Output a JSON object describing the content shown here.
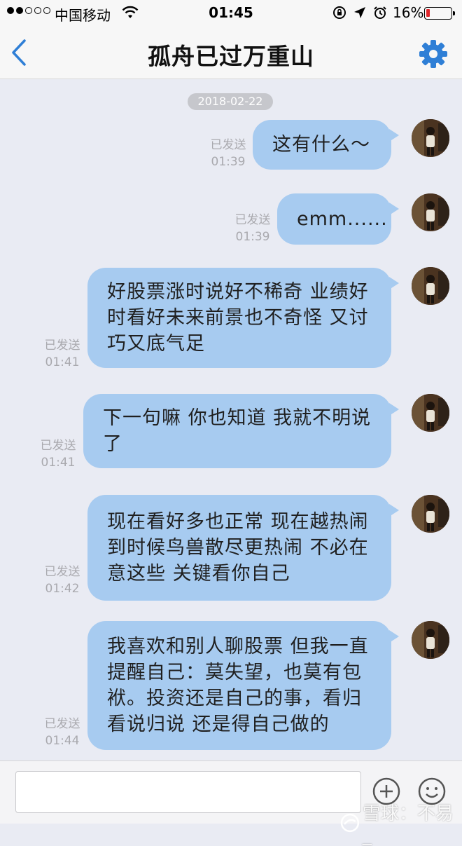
{
  "status_bar": {
    "carrier": "中国移动",
    "time": "01:45",
    "battery_percent": "16%",
    "battery_level": 0.16,
    "signal_bars_filled": 2,
    "signal_bars_total": 5,
    "battery_color": "#e0262b"
  },
  "nav": {
    "title": "孤舟已过万重山",
    "back_icon": "chevron-left-icon",
    "settings_icon": "gear-icon",
    "accent_color": "#2f7fd6"
  },
  "chat": {
    "date_separator": "2018-02-22",
    "bubble_color": "#a7cbf0",
    "messages": [
      {
        "lines": [
          "这有什么～"
        ],
        "status": "已发送",
        "time": "01:39"
      },
      {
        "lines": [
          "emm......"
        ],
        "status": "已发送",
        "time": "01:39"
      },
      {
        "lines": [
          "好股票涨时说好不稀奇 业绩好",
          "时看好未来前景也不奇怪 又讨",
          "巧又底气足"
        ],
        "status": "已发送",
        "time": "01:41"
      },
      {
        "lines": [
          "下一句嘛 你也知道 我就不明说",
          "了"
        ],
        "status": "已发送",
        "time": "01:41"
      },
      {
        "lines": [
          "现在看好多也正常 现在越热闹",
          "到时候鸟兽散尽更热闹 不必在",
          "意这些 关键看你自己"
        ],
        "status": "已发送",
        "time": "01:42"
      },
      {
        "lines": [
          "我喜欢和别人聊股票 但我一直",
          "提醒自己：莫失望，也莫有包",
          "袱。投资还是自己的事，看归",
          "看说归说 还是得自己做的"
        ],
        "status": "已发送",
        "time": "01:44"
      }
    ]
  },
  "input_bar": {
    "placeholder": "",
    "plus_icon": "plus-circle-icon",
    "emoji_icon": "smiley-icon"
  },
  "watermark": {
    "text": "雪球：不易_"
  }
}
